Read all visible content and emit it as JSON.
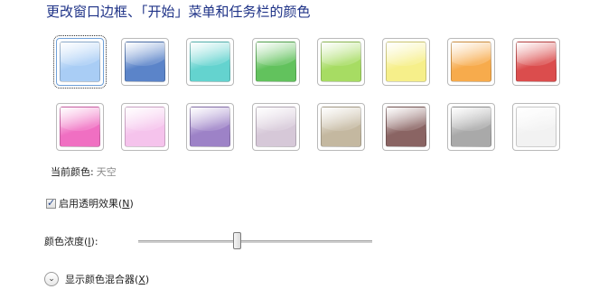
{
  "page": {
    "title": "更改窗口边框、「开始」菜单和任务栏的颜色"
  },
  "swatches": [
    {
      "name": "天空",
      "color": "#a9cdf5",
      "selected": true
    },
    {
      "name": "",
      "color": "#5b84c9"
    },
    {
      "name": "",
      "color": "#64d3cf"
    },
    {
      "name": "",
      "color": "#62c25d"
    },
    {
      "name": "",
      "color": "#a7dc63"
    },
    {
      "name": "",
      "color": "#f6ef8a"
    },
    {
      "name": "",
      "color": "#f7ab4c"
    },
    {
      "name": "",
      "color": "#db4d4d"
    },
    {
      "name": "",
      "color": "#f06fc2"
    },
    {
      "name": "",
      "color": "#f5c3ec"
    },
    {
      "name": "",
      "color": "#9d82c7"
    },
    {
      "name": "",
      "color": "#d6c8d8"
    },
    {
      "name": "",
      "color": "#c4b8a0"
    },
    {
      "name": "",
      "color": "#8a6463"
    },
    {
      "name": "",
      "color": "#a9a9a9"
    },
    {
      "name": "",
      "color": "#f2f2f2"
    }
  ],
  "current_color": {
    "label": "当前颜色:",
    "value": "天空"
  },
  "transparency": {
    "label_pre": "启用透明效果(",
    "label_key": "N",
    "label_post": ")",
    "checked": true
  },
  "intensity": {
    "label_pre": "颜色浓度(",
    "label_key": "I",
    "label_post": "):",
    "level": 0.42
  },
  "mixer": {
    "label_pre": "显示颜色混合器(",
    "label_key": "X",
    "label_post": ")"
  },
  "icons": {
    "checkbox_tick": "checkmark-icon",
    "expander": "chevron-down-icon"
  }
}
